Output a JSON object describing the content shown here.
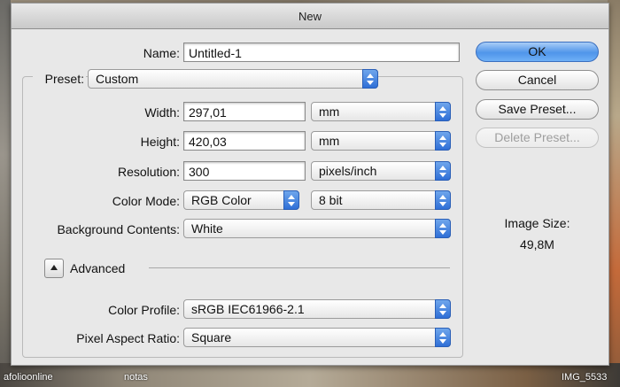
{
  "window": {
    "title": "New"
  },
  "name": {
    "label": "Name:",
    "value": "Untitled-1"
  },
  "preset": {
    "label": "Preset:",
    "value": "Custom"
  },
  "width": {
    "label": "Width:",
    "value": "297,01",
    "unit": "mm"
  },
  "height": {
    "label": "Height:",
    "value": "420,03",
    "unit": "mm"
  },
  "resolution": {
    "label": "Resolution:",
    "value": "300",
    "unit": "pixels/inch"
  },
  "color_mode": {
    "label": "Color Mode:",
    "value": "RGB Color",
    "depth": "8 bit"
  },
  "background": {
    "label": "Background Contents:",
    "value": "White"
  },
  "advanced": {
    "label": "Advanced"
  },
  "color_profile": {
    "label": "Color Profile:",
    "value": "sRGB IEC61966-2.1"
  },
  "pixel_aspect": {
    "label": "Pixel Aspect Ratio:",
    "value": "Square"
  },
  "buttons": {
    "ok": "OK",
    "cancel": "Cancel",
    "save_preset": "Save Preset...",
    "delete_preset": "Delete Preset..."
  },
  "image_size": {
    "label": "Image Size:",
    "value": "49,8M"
  },
  "background_labels": {
    "left": "afolioonline",
    "middle": "notas",
    "right": "IMG_5533"
  },
  "colors": {
    "accent": "#3f83e6",
    "dialog_bg": "#e8e8e8"
  }
}
